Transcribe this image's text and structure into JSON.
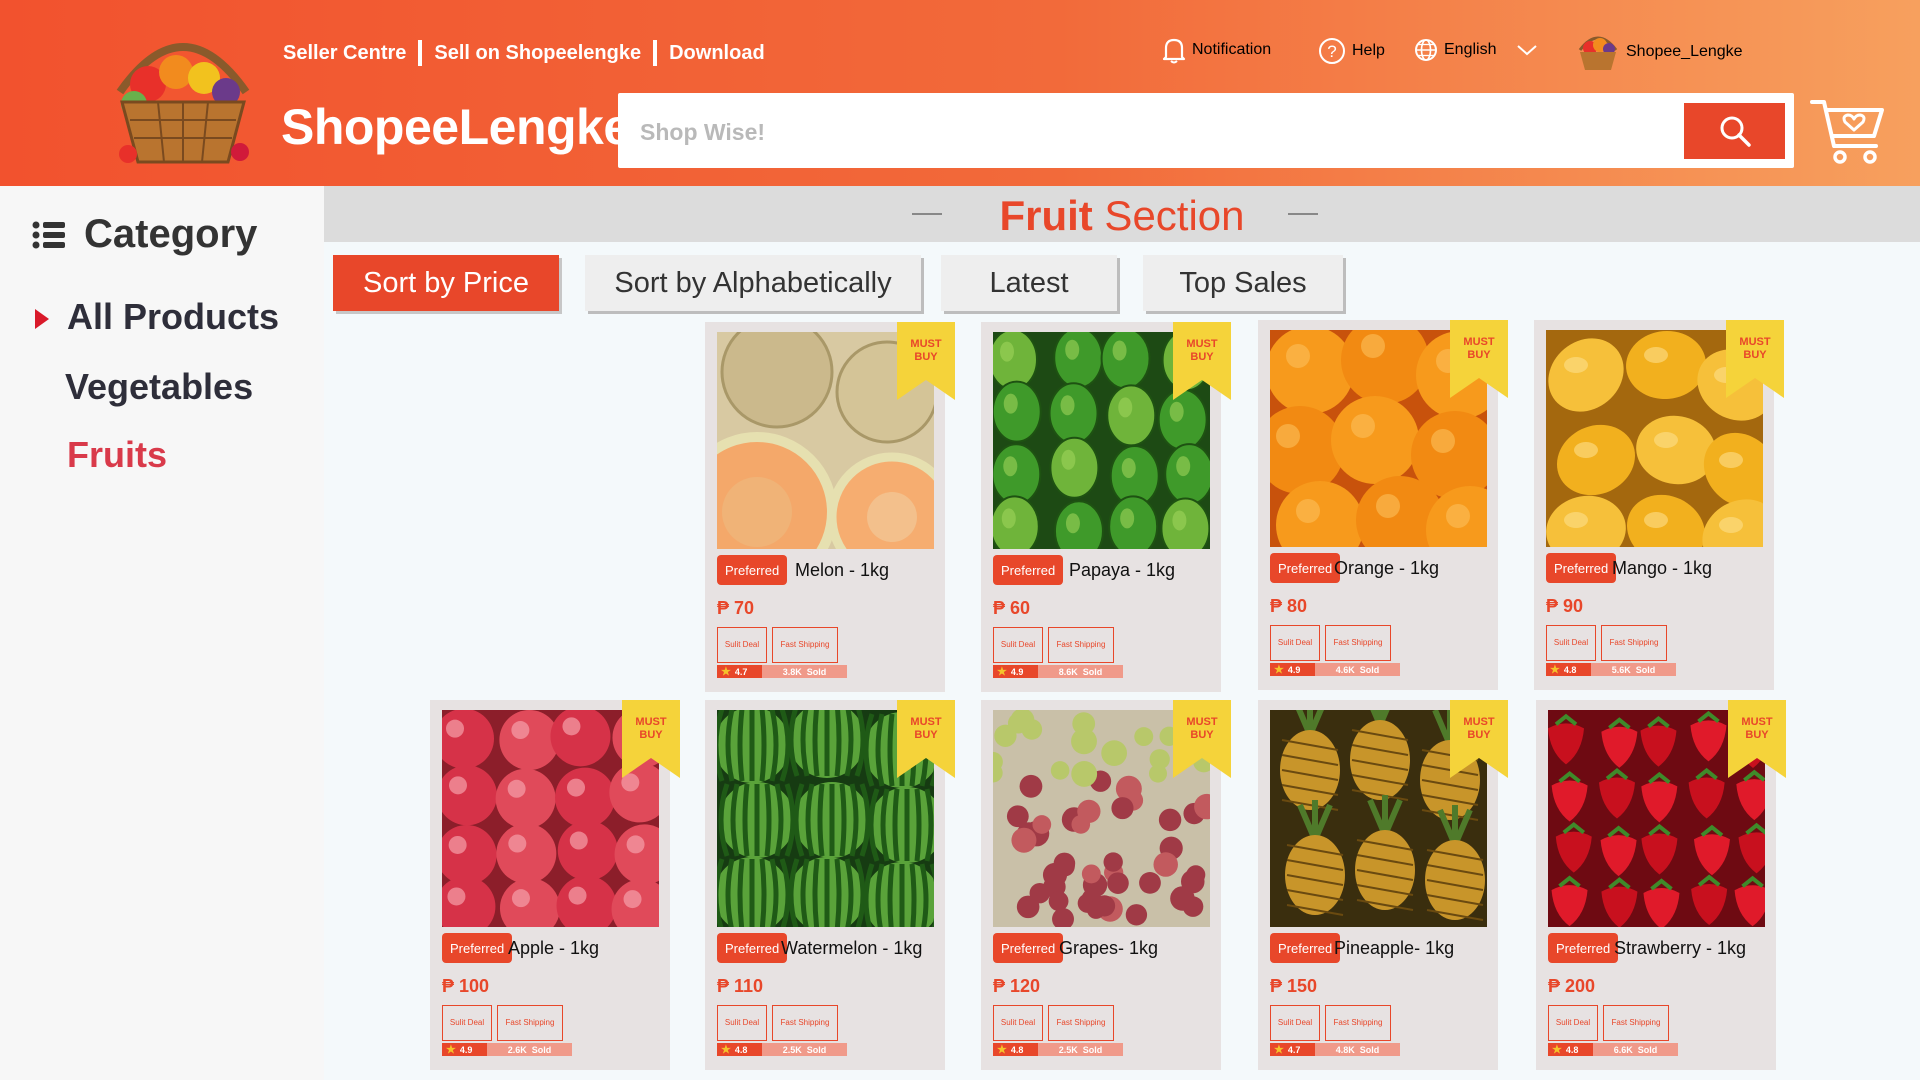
{
  "header": {
    "links": [
      "Seller Centre",
      "Sell on Shopeelengke",
      "Download"
    ],
    "brand": "ShopeeLengke",
    "search_placeholder": "Shop Wise!",
    "notification": "Notification",
    "help": "Help",
    "language": "English",
    "username": "Shopee_Lengke"
  },
  "sidebar": {
    "title": "Category",
    "items": [
      {
        "label": "All Products",
        "active": false
      },
      {
        "label": "Vegetables",
        "active": false
      },
      {
        "label": "Fruits",
        "active": true
      }
    ]
  },
  "section": {
    "title_bold": "Fruit",
    "title_rest": " Section"
  },
  "sort": [
    "Sort by Price",
    "Sort by Alphabetically",
    "Latest",
    "Top Sales"
  ],
  "labels": {
    "preferred": "Preferred",
    "must": "MUST",
    "buy": "BUY",
    "suli_deal": "Sulit Deal",
    "fast_shipping": "Fast Shipping",
    "sold_suffix": "Sold"
  },
  "products": [
    {
      "name": "Melon - 1kg",
      "price": "₱ 70",
      "rating": "4.7",
      "sold": "3.8K",
      "fruit": "melon"
    },
    {
      "name": "Papaya - 1kg",
      "price": "₱ 60",
      "rating": "4.9",
      "sold": "8.6K",
      "fruit": "papaya"
    },
    {
      "name": "Orange - 1kg",
      "price": "₱ 80",
      "rating": "4.9",
      "sold": "4.6K",
      "fruit": "orange"
    },
    {
      "name": "Mango - 1kg",
      "price": "₱ 90",
      "rating": "4.8",
      "sold": "5.6K",
      "fruit": "mango"
    },
    {
      "name": "Apple - 1kg",
      "price": "₱ 100",
      "rating": "4.9",
      "sold": "2.6K",
      "fruit": "apple"
    },
    {
      "name": "Watermelon - 1kg",
      "price": "₱ 110",
      "rating": "4.8",
      "sold": "2.5K",
      "fruit": "watermelon"
    },
    {
      "name": "Grapes- 1kg",
      "price": "₱ 120",
      "rating": "4.8",
      "sold": "2.5K",
      "fruit": "grapes"
    },
    {
      "name": "Pineapple- 1kg",
      "price": "₱ 150",
      "rating": "4.7",
      "sold": "4.8K",
      "fruit": "pineapple"
    },
    {
      "name": "Strawberry - 1kg",
      "price": "₱ 200",
      "rating": "4.8",
      "sold": "6.6K",
      "fruit": "strawberry"
    }
  ],
  "colors": {
    "accent": "#e8472a",
    "active_category": "#d93a4a",
    "ribbon": "#f5d33a"
  }
}
